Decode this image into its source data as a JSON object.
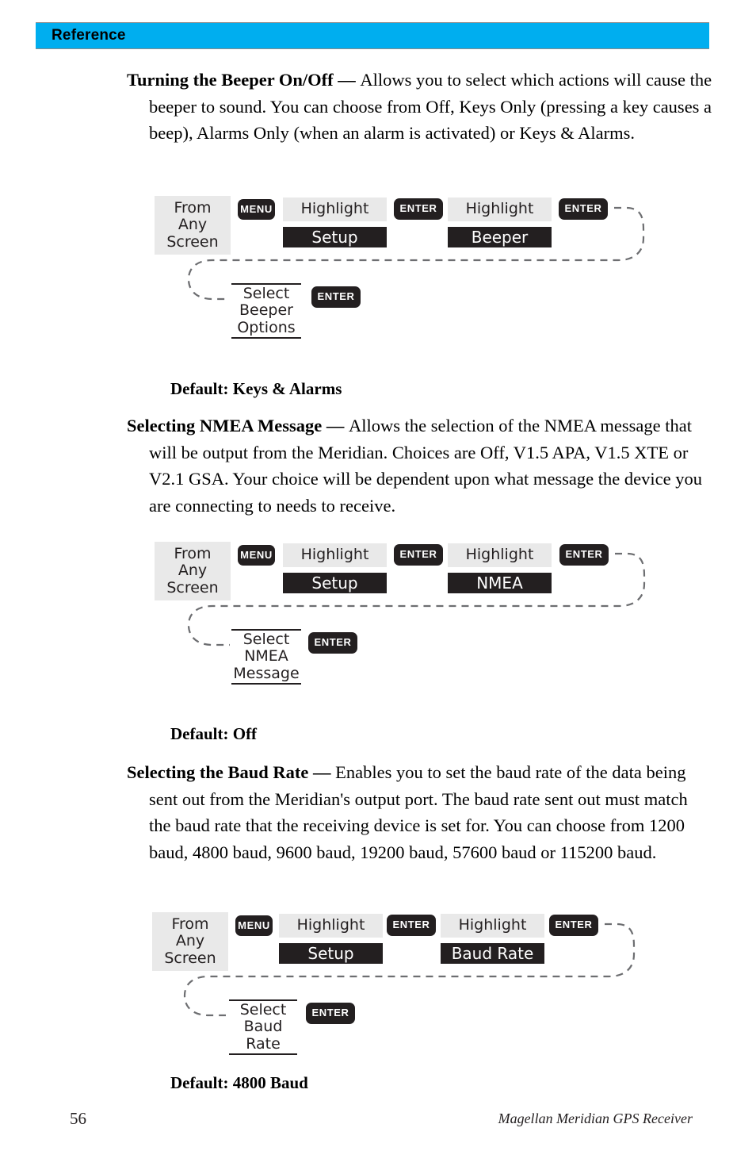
{
  "header": {
    "title": "Reference",
    "bar_color": "#00AEEF"
  },
  "sections": [
    {
      "lead": "Turning the Beeper On/Off — ",
      "body": "Allows you to select which actions will cause the beeper to sound.  You can choose from Off, Keys Only (pressing a key causes a beep), Alarms Only (when an alarm is activated) or Keys & Alarms.",
      "default": "Default: Keys & Alarms"
    },
    {
      "lead": "Selecting NMEA Message  — ",
      "body": "Allows the selection of the NMEA message that will be output from the Meridian.  Choices are Off, V1.5 APA, V1.5 XTE or V2.1 GSA.  Your choice will be dependent upon what message the device you are connecting to needs to receive.",
      "default": "Default: Off"
    },
    {
      "lead": "Selecting the Baud Rate — ",
      "body": "Enables you to set the baud rate of the data being sent out from the Meridian's output port.  The baud rate sent out must match the baud rate that the receiving device is set for.  You can choose from 1200 baud, 4800 baud, 9600 baud, 19200 baud, 57600 baud or 115200 baud.",
      "default": "Default:  4800 Baud"
    }
  ],
  "diagrams": [
    {
      "start_label_line1": "From",
      "start_label_line2": "Any",
      "start_label_line3": "Screen",
      "key1": "MENU",
      "highlight1": "Highlight",
      "target1": "Setup",
      "key2": "ENTER",
      "highlight2": "Highlight",
      "target2": "Beeper",
      "key3": "ENTER",
      "select_line1": "Select",
      "select_line2": "Beeper",
      "select_line3": "Options",
      "key4": "ENTER"
    },
    {
      "start_label_line1": "From",
      "start_label_line2": "Any",
      "start_label_line3": "Screen",
      "key1": "MENU",
      "highlight1": "Highlight",
      "target1": "Setup",
      "key2": "ENTER",
      "highlight2": "Highlight",
      "target2": "NMEA",
      "key3": "ENTER",
      "select_line1": "Select",
      "select_line2": "NMEA",
      "select_line3": "Message",
      "key4": "ENTER"
    },
    {
      "start_label_line1": "From",
      "start_label_line2": "Any",
      "start_label_line3": "Screen",
      "key1": "MENU",
      "highlight1": "Highlight",
      "target1": "Setup",
      "key2": "ENTER",
      "highlight2": "Highlight",
      "target2": "Baud Rate",
      "key3": "ENTER",
      "select_line1": "Select",
      "select_line2": "Baud",
      "select_line3": "Rate",
      "key4": "ENTER"
    }
  ],
  "footer": {
    "page_number": "56",
    "book_title": "Magellan Meridian GPS Receiver"
  }
}
